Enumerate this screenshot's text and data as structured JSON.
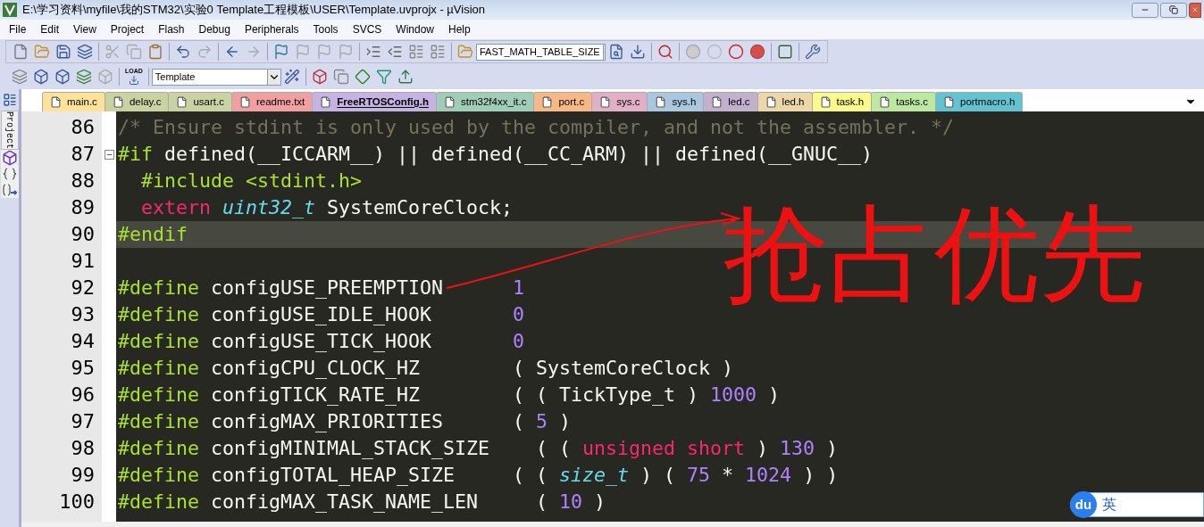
{
  "window": {
    "title": "E:\\学习资料\\myfile\\我的STM32\\实验0 Template工程模板\\USER\\Template.uvprojx - µVision"
  },
  "menu": [
    "File",
    "Edit",
    "View",
    "Project",
    "Flash",
    "Debug",
    "Peripherals",
    "Tools",
    "SVCS",
    "Window",
    "Help"
  ],
  "toolbar_1": {
    "symbol_field": {
      "value": "FAST_MATH_TABLE_SIZE"
    }
  },
  "toolbar_2": {
    "load_label": "LOAD",
    "target_field": {
      "value": "Template"
    }
  },
  "sidebar": {
    "label": "Project"
  },
  "tabs": [
    {
      "label": "main.c",
      "color": "#fde39a",
      "selected": false
    },
    {
      "label": "delay.c",
      "color": "#c9d3a1",
      "selected": false
    },
    {
      "label": "usart.c",
      "color": "#c9d3a1",
      "selected": false
    },
    {
      "label": "readme.txt",
      "color": "#f0a0a0",
      "selected": false
    },
    {
      "label": "FreeRTOSConfig.h",
      "color": "#c6b3e4",
      "selected": true
    },
    {
      "label": "stm32f4xx_it.c",
      "color": "#9fcdb7",
      "selected": false
    },
    {
      "label": "port.c",
      "color": "#f6b886",
      "selected": false
    },
    {
      "label": "sys.c",
      "color": "#e2b0c6",
      "selected": false
    },
    {
      "label": "sys.h",
      "color": "#a9c7df",
      "selected": false
    },
    {
      "label": "led.c",
      "color": "#c1b1cf",
      "selected": false
    },
    {
      "label": "led.h",
      "color": "#ecd7a7",
      "selected": false
    },
    {
      "label": "task.h",
      "color": "#f9f98e",
      "selected": false
    },
    {
      "label": "tasks.c",
      "color": "#bde8a1",
      "selected": false
    },
    {
      "label": "portmacro.h",
      "color": "#62c4d0",
      "selected": false
    }
  ],
  "editor": {
    "lines": [
      {
        "number": "86",
        "current": false,
        "fold": false,
        "tokens": [
          {
            "kind": "comment",
            "text": "/* Ensure stdint is only used by the compiler, and not the assembler. */"
          }
        ]
      },
      {
        "number": "87",
        "current": false,
        "fold": true,
        "tokens": [
          {
            "kind": "preproc",
            "text": "#if"
          },
          {
            "kind": "plain",
            "text": " defined(__ICCARM__) || defined(__CC_ARM) || defined(__GNUC__)"
          }
        ]
      },
      {
        "number": "88",
        "current": false,
        "fold": false,
        "tokens": [
          {
            "kind": "preproc",
            "text": "  #include <stdint.h>"
          }
        ]
      },
      {
        "number": "89",
        "current": false,
        "fold": false,
        "tokens": [
          {
            "kind": "keyword",
            "text": "  extern"
          },
          {
            "kind": "type",
            "text": " uint32_t"
          },
          {
            "kind": "plain",
            "text": " SystemCoreClock;"
          }
        ]
      },
      {
        "number": "90",
        "current": true,
        "fold": false,
        "tokens": [
          {
            "kind": "preproc",
            "text": "#endif"
          }
        ]
      },
      {
        "number": "91",
        "current": false,
        "fold": false
      },
      {
        "number": "92",
        "current": false,
        "fold": false,
        "tokens": [
          {
            "kind": "preproc",
            "text": "#define"
          },
          {
            "kind": "plain",
            "text": " configUSE_PREEMPTION      "
          },
          {
            "kind": "number",
            "text": "1"
          }
        ]
      },
      {
        "number": "93",
        "current": false,
        "fold": false,
        "tokens": [
          {
            "kind": "preproc",
            "text": "#define"
          },
          {
            "kind": "plain",
            "text": " configUSE_IDLE_HOOK       "
          },
          {
            "kind": "number",
            "text": "0"
          }
        ]
      },
      {
        "number": "94",
        "current": false,
        "fold": false,
        "tokens": [
          {
            "kind": "preproc",
            "text": "#define"
          },
          {
            "kind": "plain",
            "text": " configUSE_TICK_HOOK       "
          },
          {
            "kind": "number",
            "text": "0"
          }
        ]
      },
      {
        "number": "95",
        "current": false,
        "fold": false,
        "tokens": [
          {
            "kind": "preproc",
            "text": "#define"
          },
          {
            "kind": "plain",
            "text": " configCPU_CLOCK_HZ        ( SystemCoreClock )"
          }
        ]
      },
      {
        "number": "96",
        "current": false,
        "fold": false,
        "tokens": [
          {
            "kind": "preproc",
            "text": "#define"
          },
          {
            "kind": "plain",
            "text": " configTICK_RATE_HZ        ( ( TickType_t ) "
          },
          {
            "kind": "number",
            "text": "1000"
          },
          {
            "kind": "plain",
            "text": " )"
          }
        ]
      },
      {
        "number": "97",
        "current": false,
        "fold": false,
        "tokens": [
          {
            "kind": "preproc",
            "text": "#define"
          },
          {
            "kind": "plain",
            "text": " configMAX_PRIORITIES      ( "
          },
          {
            "kind": "number",
            "text": "5"
          },
          {
            "kind": "plain",
            "text": " )"
          }
        ]
      },
      {
        "number": "98",
        "current": false,
        "fold": false,
        "tokens": [
          {
            "kind": "preproc",
            "text": "#define"
          },
          {
            "kind": "plain",
            "text": " configMINIMAL_STACK_SIZE    ( ( "
          },
          {
            "kind": "keyword",
            "text": "unsigned short"
          },
          {
            "kind": "plain",
            "text": " ) "
          },
          {
            "kind": "number",
            "text": "130"
          },
          {
            "kind": "plain",
            "text": " )"
          }
        ]
      },
      {
        "number": "99",
        "current": false,
        "fold": false,
        "tokens": [
          {
            "kind": "preproc",
            "text": "#define"
          },
          {
            "kind": "plain",
            "text": " configTOTAL_HEAP_SIZE     ( ( "
          },
          {
            "kind": "type",
            "text": "size_t"
          },
          {
            "kind": "plain",
            "text": " ) ( "
          },
          {
            "kind": "number",
            "text": "75"
          },
          {
            "kind": "plain",
            "text": " * "
          },
          {
            "kind": "number",
            "text": "1024"
          },
          {
            "kind": "plain",
            "text": " ) )"
          }
        ]
      },
      {
        "number": "100",
        "current": false,
        "fold": false,
        "tokens": [
          {
            "kind": "preproc",
            "text": "#define"
          },
          {
            "kind": "plain",
            "text": " configMAX_TASK_NAME_LEN     ( "
          },
          {
            "kind": "number",
            "text": "10"
          },
          {
            "kind": "plain",
            "text": " )"
          }
        ]
      }
    ]
  },
  "annotation": {
    "text": "抢占优先"
  },
  "ime_bar": {
    "logo": "du",
    "mode": "英"
  }
}
